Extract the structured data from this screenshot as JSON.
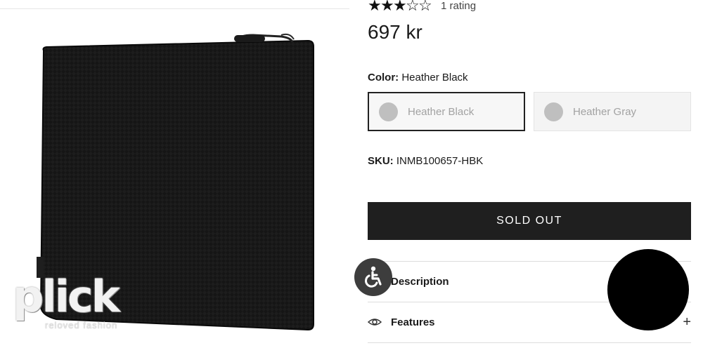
{
  "brand": {
    "logo_text": "plick",
    "tagline": "reloved fashion"
  },
  "product": {
    "rating_stars": 3,
    "rating_max": 5,
    "rating_count_text": "1 rating",
    "price": "697 kr",
    "color_label": "Color:",
    "color_value": "Heather Black",
    "swatches": [
      {
        "label": "Heather Black",
        "selected": true,
        "dot_color": "#bfbfbf"
      },
      {
        "label": "Heather Gray",
        "selected": false,
        "dot_color": "#bfbfbf"
      }
    ],
    "sku_label": "SKU:",
    "sku_value": "INMB100657-HBK",
    "button_label": "SOLD OUT"
  },
  "accordion": {
    "description_label": "Description",
    "features_label": "Features",
    "expand_symbol": "+"
  },
  "colors": {
    "button_bg": "#1f1f1f",
    "a11y_bg": "#3d3d3d",
    "chat_bg": "#000000"
  },
  "icons": [
    "star-icon",
    "eye-icon",
    "plus-icon",
    "wheelchair-icon",
    "chat-icon"
  ]
}
